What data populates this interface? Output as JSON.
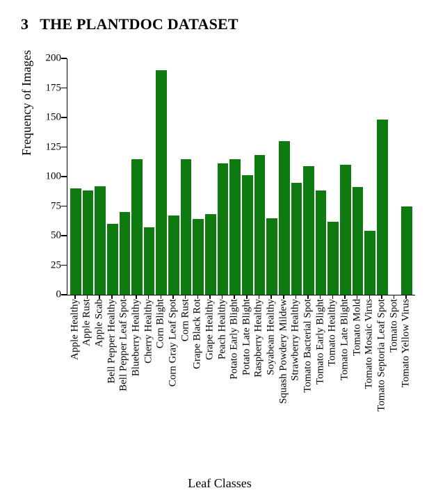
{
  "heading": {
    "number": "3",
    "text": "THE PLANTDOC DATASET"
  },
  "chart_data": {
    "type": "bar",
    "title": "",
    "xlabel": "Leaf Classes",
    "ylabel": "Frequency of Images",
    "ylim": [
      0,
      200
    ],
    "yticks": [
      0,
      25,
      50,
      75,
      100,
      125,
      150,
      175,
      200
    ],
    "bar_color": "#0f7a0f",
    "categories": [
      "Apple Healthy",
      "Apple Rust",
      "Apple Scab",
      "Bell Pepper Healthy",
      "Bell Pepper Leaf Spot",
      "Blueberry Healthy",
      "Cherry Healthy",
      "Corn Blight",
      "Corn Gray Leaf Spot",
      "Corn Rust",
      "Grape Black Rot",
      "Grape Healthy",
      "Peach Healthy",
      "Potato Early Blight",
      "Potato Late Blight",
      "Raspberry Healthy",
      "Soyabean Healthy",
      "Squash Powdery Mildew",
      "Strawberry Healthy",
      "Tomato Bacterial Spot",
      "Tomato Early Blight",
      "Tomato Healthy",
      "Tomato Late Blight",
      "Tomato Mold",
      "Tomato Mosaic Virus",
      "Tomato Septoria Leaf Spot",
      "Tomato Spot",
      "Tomato Yellow Virus"
    ],
    "values": [
      90,
      88,
      92,
      60,
      70,
      115,
      57,
      190,
      67,
      115,
      64,
      68,
      111,
      115,
      101,
      118,
      65,
      130,
      95,
      109,
      88,
      62,
      110,
      91,
      54,
      148,
      0,
      75
    ]
  }
}
